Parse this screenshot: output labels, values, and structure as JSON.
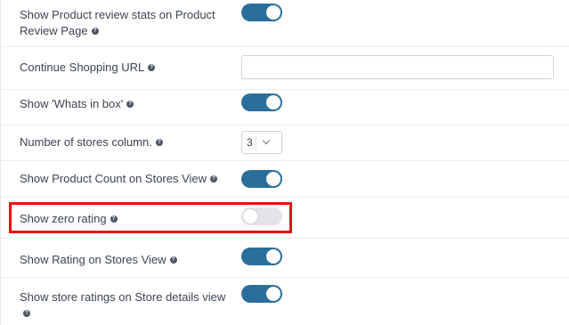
{
  "settings": {
    "review_stats": {
      "label": "Show Product review stats on Product Review Page",
      "enabled": true,
      "help_icon": "question-circle-icon"
    },
    "continue_shopping_url": {
      "label": "Continue Shopping URL",
      "value": "",
      "placeholder": "",
      "help_icon": "question-circle-icon"
    },
    "whats_in_box": {
      "label": "Show 'Whats in box'",
      "enabled": true,
      "help_icon": "question-circle-icon"
    },
    "stores_column": {
      "label": "Number of stores column.",
      "value": "3",
      "help_icon": "question-circle-icon"
    },
    "product_count": {
      "label": "Show Product Count on Stores View",
      "enabled": true,
      "help_icon": "question-circle-icon"
    },
    "zero_rating": {
      "label": "Show zero rating",
      "enabled": false,
      "help_icon": "question-circle-icon"
    },
    "rating_stores": {
      "label": "Show Rating on Stores View",
      "enabled": true,
      "help_icon": "question-circle-icon"
    },
    "store_ratings_details": {
      "label": "Show store ratings on Store details view",
      "enabled": true,
      "help_icon": "question-circle-icon"
    }
  },
  "help_glyph": "?",
  "colors": {
    "toggle_on": "#2a6f9a",
    "toggle_off": "#e2e4e7",
    "highlight": "#e51313",
    "text": "#3c4450"
  }
}
